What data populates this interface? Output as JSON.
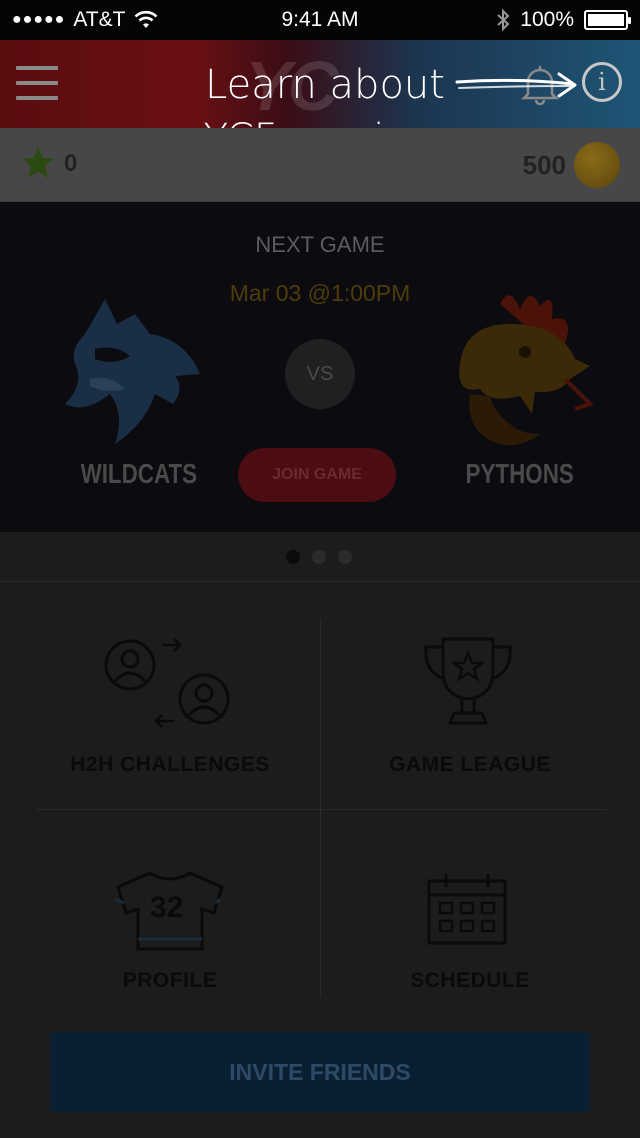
{
  "status_bar": {
    "signal": "●●●●●",
    "carrier": "AT&T",
    "time": "9:41 AM",
    "battery": "100%"
  },
  "header": {
    "logo_text": "YC"
  },
  "coach_mark": {
    "line1": "Learn about",
    "line2": "YCF scoring."
  },
  "score_bar": {
    "stars": "0",
    "coins": "500"
  },
  "next_game": {
    "label": "NEXT GAME",
    "date": "Mar 03 @1:00PM",
    "vs": "VS",
    "home_team": "WILDCATS",
    "away_team": "PYTHONS",
    "join_label": "JOIN GAME"
  },
  "pager": {
    "pages": 3,
    "active": 0
  },
  "menu": {
    "h2h": "H2H CHALLENGES",
    "league": "GAME LEAGUE",
    "profile": "PROFILE",
    "jersey_number": "32",
    "schedule": "SCHEDULE"
  },
  "invite_label": "INVITE FRIENDS"
}
